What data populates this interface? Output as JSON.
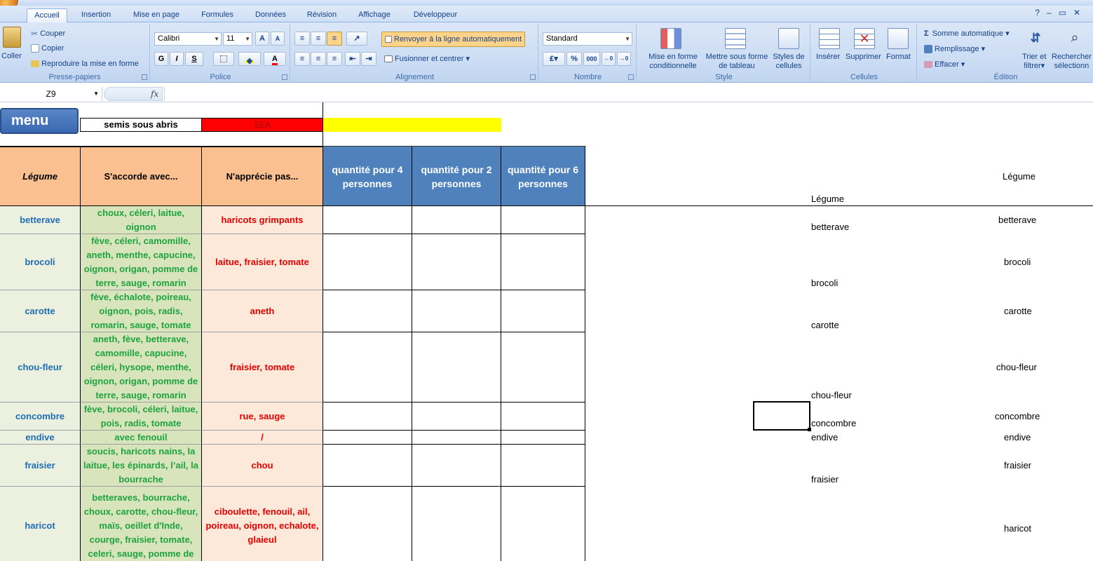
{
  "ribbon_tabs": [
    "Accueil",
    "Insertion",
    "Mise en page",
    "Formules",
    "Données",
    "Révision",
    "Affichage",
    "Développeur"
  ],
  "clipboard": {
    "paste": "Coller",
    "cut": "Couper",
    "copy": "Copier",
    "format_painter": "Reproduire la mise en forme",
    "label": "Presse-papiers"
  },
  "font": {
    "name": "Calibri",
    "size": "11",
    "bold": "G",
    "italic": "I",
    "underline": "S",
    "label": "Police"
  },
  "alignment": {
    "wrap": "Renvoyer à la ligne automatiquement",
    "merge": "Fusionner et centrer",
    "label": "Alignement"
  },
  "number": {
    "format": "Standard",
    "percent": "%",
    "thousands": "000",
    "label": "Nombre"
  },
  "style": {
    "conditional": "Mise en forme conditionnelle",
    "as_table": "Mettre sous forme de tableau",
    "cell_styles": "Styles de cellules",
    "label": "Style"
  },
  "cells": {
    "insert": "Insérer",
    "delete": "Supprimer",
    "format": "Format",
    "label": "Cellules"
  },
  "editing": {
    "autosum": "Somme automatique",
    "fill": "Remplissage",
    "clear": "Effacer",
    "sort_1": "Trier et",
    "sort_2": "filtrer",
    "find_1": "Rechercher",
    "find_2": "sélectionn",
    "label": "Édition"
  },
  "formula_bar": {
    "cell_ref": "Z9",
    "fx": "fx",
    "content": ""
  },
  "sheet": {
    "menu_button": "menu",
    "legend_white": "semis sous abris",
    "legend_red": "SEA",
    "legend_colors": {
      "red": "#ff0000",
      "yellow": "#ffff00"
    },
    "headers": {
      "legume": "Légume",
      "accorde": "S'accorde avec...",
      "apprecie": "N'apprécie pas...",
      "q4": "quantité pour 4 personnes",
      "q2": "quantité pour 2 personnes",
      "q6": "quantité pour 6 personnes"
    },
    "rows": [
      {
        "legume": "betterave",
        "accorde": "choux, céleri, laitue, oignon",
        "apprecie": "haricots grimpants"
      },
      {
        "legume": "brocoli",
        "accorde": "fève, céleri, camomille, aneth, menthe, capucine, oignon, origan, pomme de terre, sauge, romarin",
        "apprecie": "laitue, fraisier, tomate"
      },
      {
        "legume": "carotte",
        "accorde": "fève, échalote, poireau, oignon, pois, radis, romarin, sauge, tomate",
        "apprecie": "aneth"
      },
      {
        "legume": "chou-fleur",
        "accorde": "aneth, fève, betterave, camomille, capucine, céleri, hysope, menthe, oignon, origan, pomme de terre, sauge, romarin",
        "apprecie": "fraisier, tomate"
      },
      {
        "legume": "concombre",
        "accorde": "fève, brocoli, céleri, laitue, pois, radis, tomate",
        "apprecie": "rue, sauge"
      },
      {
        "legume": "endive",
        "accorde": "avec fenouil",
        "apprecie": "/"
      },
      {
        "legume": "fraisier",
        "accorde": "soucis, haricots nains, la laitue, les épinards, l’ail, la bourrache",
        "apprecie": "chou"
      },
      {
        "legume": "haricot",
        "accorde": "betteraves, bourrache, choux, carotte, chou-fleur, maïs, oeillet d'Inde, courge, fraisier, tomate, celeri, sauge, pomme de",
        "apprecie": "ciboulette, fenouil, ail, poireau, oignon, echalote, glaieul"
      }
    ],
    "col_m": {
      "header": "Légume",
      "items": [
        "betterave",
        "brocoli",
        "carotte",
        "chou-fleur",
        "concombre",
        "endive",
        "fraisier"
      ]
    },
    "col_r": {
      "header": "Légume",
      "items": [
        "betterave",
        "brocoli",
        "carotte",
        "chou-fleur",
        "concombre",
        "endive",
        "fraisier",
        "haricot"
      ]
    }
  }
}
